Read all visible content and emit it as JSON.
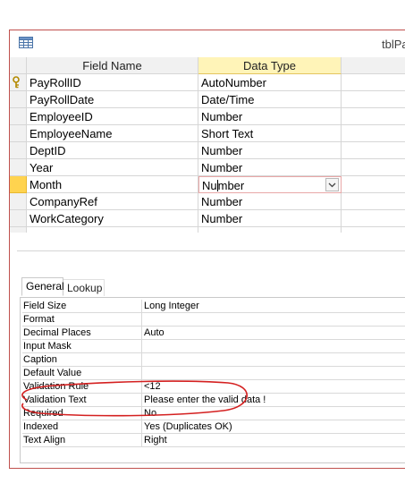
{
  "window": {
    "title": "tblPa",
    "table_icon": "table-icon"
  },
  "grid": {
    "headers": {
      "field_name": "Field Name",
      "data_type": "Data Type"
    },
    "rows": [
      {
        "field_name": "PayRollID",
        "data_type": "AutoNumber",
        "primary_key": true
      },
      {
        "field_name": "PayRollDate",
        "data_type": "Date/Time"
      },
      {
        "field_name": "EmployeeID",
        "data_type": "Number"
      },
      {
        "field_name": "EmployeeName",
        "data_type": "Short Text"
      },
      {
        "field_name": "DeptID",
        "data_type": "Number"
      },
      {
        "field_name": "Year",
        "data_type": "Number"
      },
      {
        "field_name": "Month",
        "data_type_before_caret": "Nu",
        "data_type_after_caret": "mber",
        "selected": true
      },
      {
        "field_name": "CompanyRef",
        "data_type": "Number"
      },
      {
        "field_name": "WorkCategory",
        "data_type": "Number"
      }
    ]
  },
  "properties": {
    "tabs": [
      {
        "label": "General",
        "active": true
      },
      {
        "label": "Lookup",
        "active": false
      }
    ],
    "rows": [
      {
        "label": "Field Size",
        "value": "Long Integer"
      },
      {
        "label": "Format",
        "value": ""
      },
      {
        "label": "Decimal Places",
        "value": "Auto"
      },
      {
        "label": "Input Mask",
        "value": ""
      },
      {
        "label": "Caption",
        "value": ""
      },
      {
        "label": "Default Value",
        "value": ""
      },
      {
        "label": "Validation Rule",
        "value": "<12"
      },
      {
        "label": "Validation Text",
        "value": "Please enter the valid data !"
      },
      {
        "label": "Required",
        "value": "No"
      },
      {
        "label": "Indexed",
        "value": "Yes (Duplicates OK)"
      },
      {
        "label": "Text Align",
        "value": "Right"
      }
    ]
  },
  "colors": {
    "selected_row_marker": "#ffd34f",
    "header_highlight": "#fff4b8",
    "annotation_red": "#d42020"
  }
}
